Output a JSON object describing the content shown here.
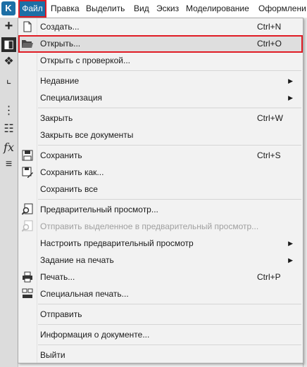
{
  "menubar": {
    "items": [
      "Файл",
      "Правка",
      "Выделить",
      "Вид",
      "Эскиз",
      "Моделирование",
      "Оформлени"
    ]
  },
  "colors": {
    "accent": "#1c6fa6",
    "highlight_outline": "#e01b24"
  },
  "file_menu": {
    "items": [
      {
        "label": "Создать...",
        "shortcut": "Ctrl+N",
        "icon": "new-document-icon"
      },
      {
        "label": "Открыть...",
        "shortcut": "Ctrl+O",
        "icon": "folder-open-icon"
      },
      {
        "label": "Открыть с проверкой..."
      },
      {
        "label": "Недавние",
        "submenu": "▶"
      },
      {
        "label": "Специализация",
        "submenu": "▶"
      },
      {
        "label": "Закрыть",
        "shortcut": "Ctrl+W"
      },
      {
        "label": "Закрыть все документы"
      },
      {
        "label": "Сохранить",
        "shortcut": "Ctrl+S",
        "icon": "save-icon"
      },
      {
        "label": "Сохранить как...",
        "icon": "save-as-icon"
      },
      {
        "label": "Сохранить все"
      },
      {
        "label": "Предварительный просмотр...",
        "icon": "print-preview-icon"
      },
      {
        "label": "Отправить выделенное в предварительный просмотр...",
        "icon": "send-to-preview-icon"
      },
      {
        "label": "Настроить предварительный просмотр",
        "submenu": "▶"
      },
      {
        "label": "Задание на печать",
        "submenu": "▶"
      },
      {
        "label": "Печать...",
        "shortcut": "Ctrl+P",
        "icon": "printer-icon"
      },
      {
        "label": "Специальная печать...",
        "icon": "special-print-icon"
      },
      {
        "label": "Отправить"
      },
      {
        "label": "Информация о документе..."
      },
      {
        "label": "Выйти"
      }
    ]
  }
}
